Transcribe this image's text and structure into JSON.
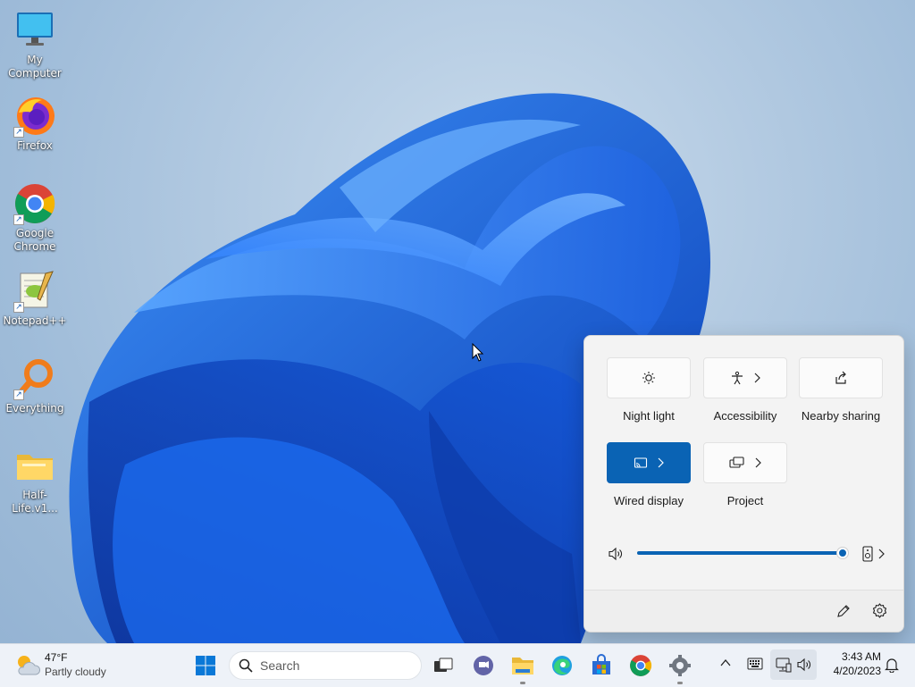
{
  "desktop": {
    "icons": [
      {
        "label": "My Computer"
      },
      {
        "label": "Firefox"
      },
      {
        "label": "Google Chrome"
      },
      {
        "label": "Notepad++"
      },
      {
        "label": "Everything"
      },
      {
        "label": "Half-Life.v1..."
      }
    ]
  },
  "quick_settings": {
    "tiles": [
      {
        "label": "Night light",
        "icon": "night-light-icon",
        "active": false
      },
      {
        "label": "Accessibility",
        "icon": "accessibility-icon",
        "active": false,
        "expandable": true
      },
      {
        "label": "Nearby sharing",
        "icon": "share-icon",
        "active": false
      },
      {
        "label": "Wired display",
        "icon": "cast-icon",
        "active": true,
        "expandable": true
      },
      {
        "label": "Project",
        "icon": "project-icon",
        "active": false,
        "expandable": true
      }
    ],
    "volume": {
      "level_percent": 100
    },
    "accent_color": "#0a63b4"
  },
  "taskbar": {
    "weather": {
      "temp": "47°F",
      "condition": "Partly cloudy"
    },
    "search_placeholder": "Search",
    "clock": {
      "time": "3:43 AM",
      "date": "4/20/2023"
    }
  }
}
